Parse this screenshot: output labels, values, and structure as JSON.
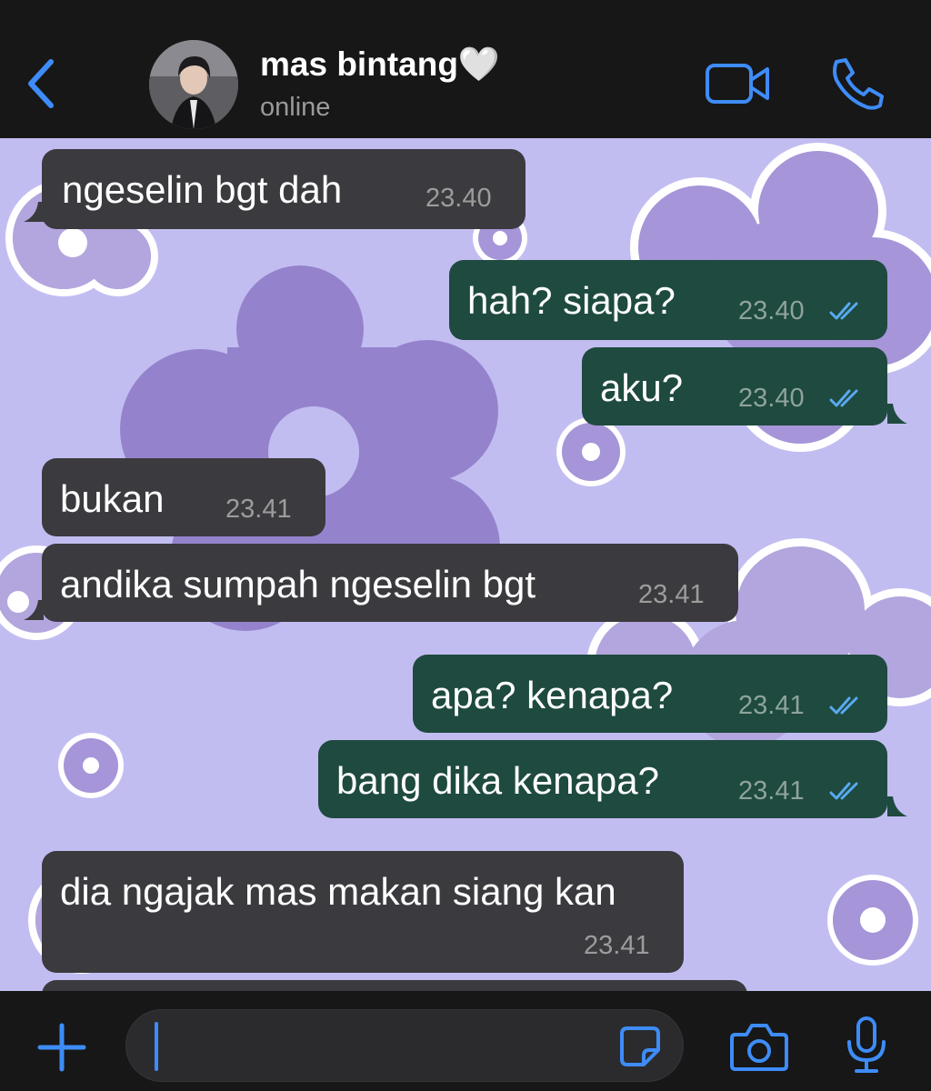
{
  "header": {
    "contact_name": "mas bintang🤍",
    "status": "online",
    "icons": [
      "back-chevron-icon",
      "video-call-icon",
      "phone-call-icon"
    ],
    "accent_color": "#3e8cf7"
  },
  "messages": [
    {
      "direction": "incoming",
      "text": "ngeselin bgt dah",
      "time": "23.40"
    },
    {
      "direction": "outgoing",
      "text": "hah? siapa?",
      "time": "23.40",
      "read": true
    },
    {
      "direction": "outgoing",
      "text": "aku?",
      "time": "23.40",
      "read": true
    },
    {
      "direction": "incoming",
      "text": "bukan",
      "time": "23.41"
    },
    {
      "direction": "incoming",
      "text": "andika sumpah ngeselin bgt",
      "time": "23.41"
    },
    {
      "direction": "outgoing",
      "text": "apa? kenapa?",
      "time": "23.41",
      "read": true
    },
    {
      "direction": "outgoing",
      "text": "bang dika kenapa?",
      "time": "23.41",
      "read": true
    },
    {
      "direction": "incoming",
      "text": "dia ngajak mas makan siang kan",
      "time": "23.41"
    }
  ],
  "colors": {
    "incoming_bubble": "#3b3a3e",
    "outgoing_bubble": "#1e4a3f",
    "read_ticks": "#5aa9f0",
    "wallpaper": "#c2bdf1"
  },
  "input_bar": {
    "value": "",
    "icons": [
      "plus-icon",
      "sticker-icon",
      "camera-icon",
      "microphone-icon"
    ]
  }
}
